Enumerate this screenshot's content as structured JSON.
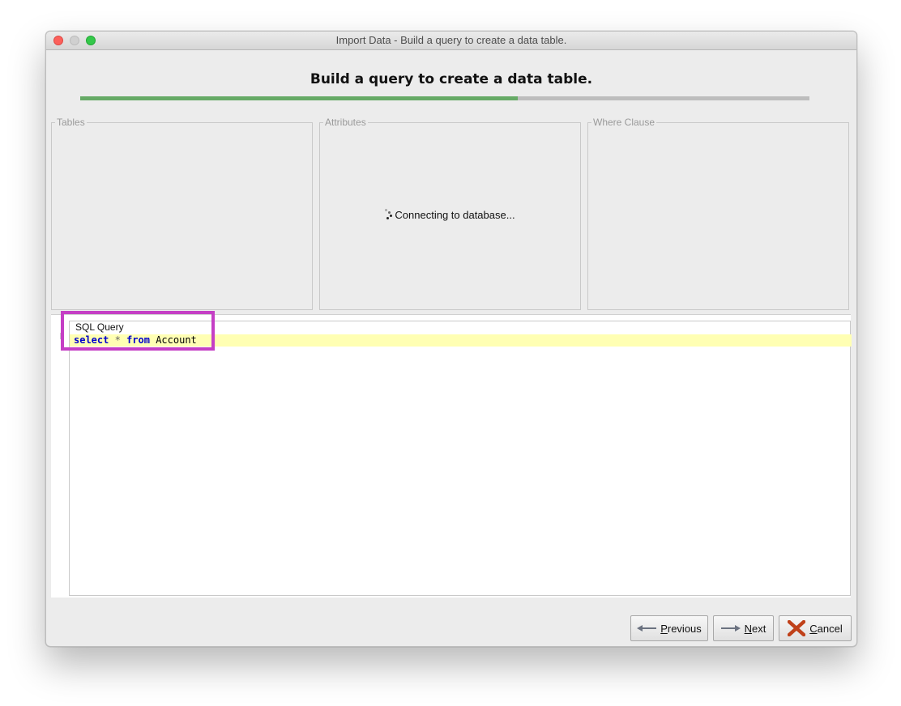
{
  "window": {
    "title": "Import Data - Build a query to create a data table."
  },
  "wizard": {
    "heading": "Build a query to create a data table.",
    "progress_fraction": 0.6
  },
  "panels": {
    "tables_label": "Tables",
    "attributes_label": "Attributes",
    "where_label": "Where Clause",
    "loading_text": "Connecting to database..."
  },
  "sql": {
    "label": "SQL Query",
    "tokens": {
      "kw_select": "select",
      "op_star": "*",
      "kw_from": "from",
      "table_name": "Account"
    }
  },
  "buttons": {
    "previous_mnemonic": "P",
    "previous_rest": "revious",
    "next_mnemonic": "N",
    "next_rest": "ext",
    "cancel_mnemonic": "C",
    "cancel_rest": "ancel"
  },
  "colors": {
    "progress_fill": "#66aa66",
    "highlight_box": "#c53fc5",
    "keyword": "#0000cc",
    "current_line": "#ffffb3"
  },
  "icons": {
    "previous": "arrow-left-icon",
    "next": "arrow-right-icon",
    "cancel": "cancel-x-icon",
    "loading": "spinner-icon"
  }
}
